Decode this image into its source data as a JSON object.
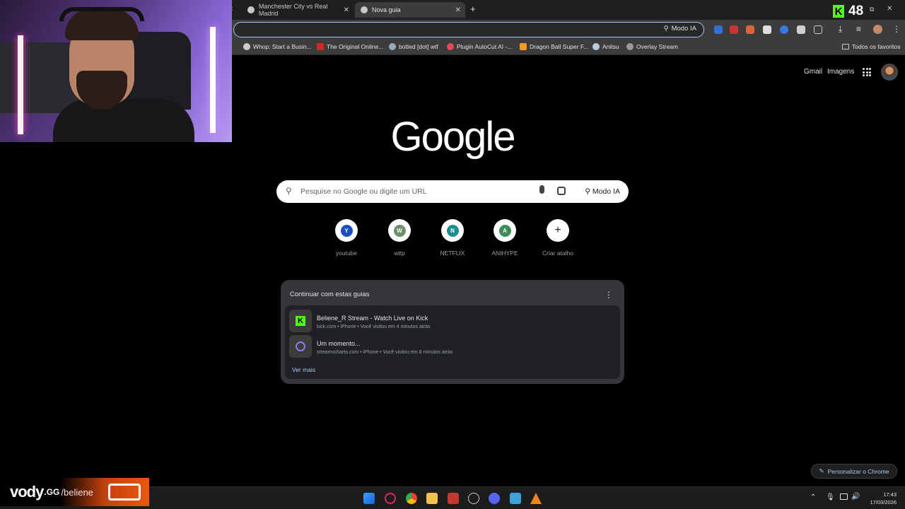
{
  "tabs": [
    {
      "title": "Manchester City vs Real Madrid",
      "active": false
    },
    {
      "title": "Nova guia",
      "active": true
    }
  ],
  "kick_overlay": {
    "count": "48"
  },
  "toolbar": {
    "modo_ia": "Modo IA"
  },
  "bookmarks": [
    {
      "label": "Whop: Start a Busin..."
    },
    {
      "label": "The Original Online..."
    },
    {
      "label": "botted [dot] wtf"
    },
    {
      "label": "Plugin AutoCut AI -..."
    },
    {
      "label": "Dragon Ball Super F..."
    },
    {
      "label": "Anitsu"
    },
    {
      "label": "Overlay Stream"
    }
  ],
  "bookmarks_all": "Todos os favoritos",
  "header_links": {
    "gmail": "Gmail",
    "images": "Imagens"
  },
  "google_logo": "Google",
  "search": {
    "placeholder": "Pesquise no Google ou digite um URL",
    "modo_ia": "Modo IA"
  },
  "shortcuts": [
    {
      "label": "youtube",
      "letter": "Y",
      "color": "#1a4fc0"
    },
    {
      "label": "wttp",
      "letter": "W",
      "color": "#6b8e6b"
    },
    {
      "label": "NETFLIX",
      "letter": "N",
      "color": "#1a8f8f"
    },
    {
      "label": "ANIHYPE",
      "letter": "A",
      "color": "#3d8a5a"
    },
    {
      "label": "Criar atalho",
      "letter": "+",
      "color": "#ffffff"
    }
  ],
  "continue_card": {
    "title": "Continuar com estas guias",
    "items": [
      {
        "title": "Beliene_R Stream - Watch Live on Kick",
        "meta": "kick.com • iPhone • Você visitou em 4 minutos atrás"
      },
      {
        "title": "Um momento...",
        "meta": "streamscharts.com • iPhone • Você visitou em 8 minutos atrás"
      }
    ],
    "ver_mais": "Ver mais"
  },
  "personalize": "Personalizar o Chrome",
  "clock": {
    "time": "17:43",
    "date": "17/03/2026"
  },
  "vody": {
    "brand": "vody",
    "tld": ".GG",
    "user": "/beliene"
  }
}
